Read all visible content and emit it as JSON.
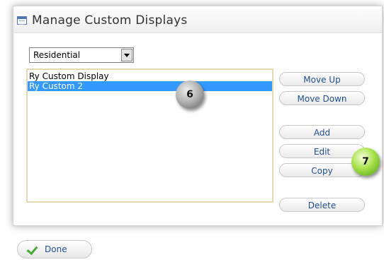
{
  "dialog": {
    "title": "Manage Custom Displays",
    "title_icon": "window-icon"
  },
  "filter": {
    "selected": "Residential"
  },
  "list": {
    "items": [
      {
        "label": "Ry Custom Display",
        "selected": false
      },
      {
        "label": "Ry Custom 2",
        "selected": true
      }
    ]
  },
  "actions": {
    "move_up": "Move Up",
    "move_down": "Move Down",
    "add": "Add",
    "edit": "Edit",
    "copy": "Copy",
    "delete": "Delete"
  },
  "callouts": {
    "list_marker": "6",
    "actions_marker": "7"
  },
  "footer": {
    "done": "Done",
    "done_icon": "checkmark-icon"
  },
  "colors": {
    "selection": "#3399ff",
    "button_text": "#1f4f8f",
    "marker_gray": "#b5b5b5",
    "marker_green": "#a8e24a"
  }
}
